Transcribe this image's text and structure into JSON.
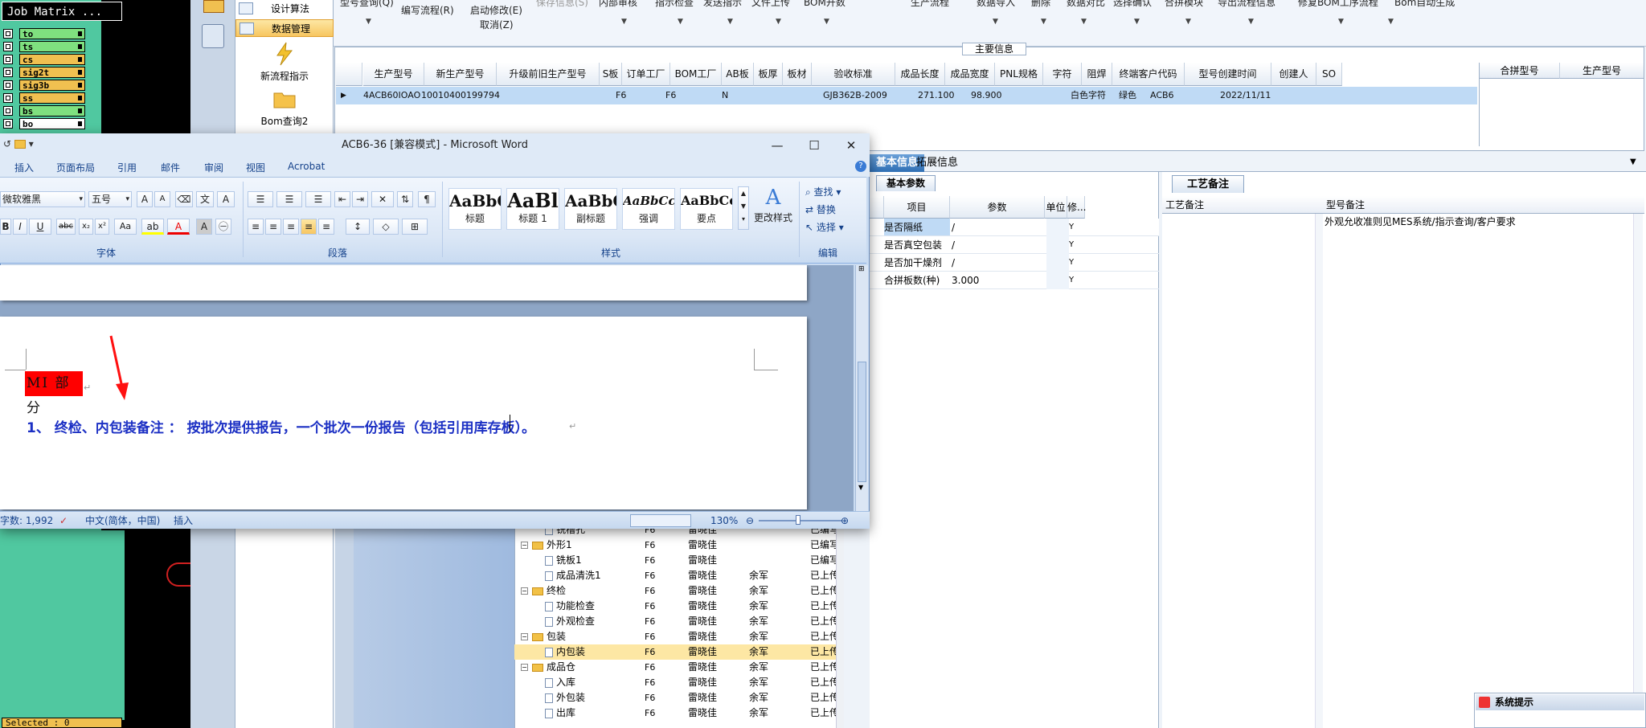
{
  "job_matrix": {
    "title": "Job Matrix ...",
    "layers": [
      {
        "name": "to",
        "color": "#7fe07f"
      },
      {
        "name": "ts",
        "color": "#7fe07f"
      },
      {
        "name": "cs",
        "color": "#f0c050"
      },
      {
        "name": "sig2t",
        "color": "#f0c050"
      },
      {
        "name": "sig3b",
        "color": "#f0c050"
      },
      {
        "name": "ss",
        "color": "#f0c050"
      },
      {
        "name": "bs",
        "color": "#7fe07f"
      },
      {
        "name": "bo",
        "color": "#ffffff"
      }
    ],
    "selected": "Selected : 0"
  },
  "mes_nav": {
    "design_calc": "设计算法",
    "data_mgmt": "数据管理",
    "new_flow": "新流程指示",
    "bom_query": "Bom查询2"
  },
  "menubar": {
    "row1": [
      "型号查询(Q)",
      "保存信息(S)",
      "内部审核",
      "指示检查",
      "发送指示",
      "文件上传",
      "BOM开数",
      "生产流程",
      "数据导入",
      "删除",
      "数据对比",
      "选择确认",
      "合拼模块",
      "导出流程信息",
      "修复BOM工序流程",
      "Bom自动生成"
    ],
    "edit_flow": "编写流程(R)",
    "start_modify": "启动修改(E)",
    "cancel": "取消(Z)"
  },
  "main_info": {
    "title": "主要信息",
    "headers": [
      "生产型号",
      "新生产型号",
      "升级前旧生产型号",
      "S板",
      "订单工厂",
      "BOM工厂",
      "AB板",
      "板厚",
      "板材",
      "验收标准",
      "成品长度",
      "成品宽度",
      "PNL规格",
      "字符",
      "阻焊",
      "终端客户代码",
      "型号创建时间",
      "创建人",
      "SO"
    ],
    "row": {
      "model": "4ACB60IOAO",
      "new_model": "10010400199794",
      "order_factory": "F6",
      "bom_factory": "F6",
      "ab": "N",
      "standard": "GJB362B-2009",
      "length": "271.100",
      "width": "98.900",
      "char": "白色字符",
      "solder": "绿色",
      "customer": "ACB6",
      "created": "2022/11/11"
    },
    "right_headers": [
      "合拼型号",
      "生产型号"
    ]
  },
  "tabs": {
    "basic": "基本信息",
    "ext": "拓展信息"
  },
  "basic_params": {
    "tab": "基本参数",
    "headers": [
      "项目",
      "参数",
      "单位",
      "修..."
    ],
    "rows": [
      {
        "item": "是否隔纸",
        "param": "/",
        "flag": "Y"
      },
      {
        "item": "是否真空包装",
        "param": "/",
        "flag": "Y"
      },
      {
        "item": "是否加干燥剂",
        "param": "/",
        "flag": "Y"
      },
      {
        "item": "合拼板数(种)",
        "param": "3.000",
        "flag": "Y"
      }
    ]
  },
  "process_remark": {
    "tab": "工艺备注",
    "col1": "工艺备注",
    "col2": "型号备注",
    "text": "外观允收准则见MES系统/指示查询/客户要求"
  },
  "sys_note": "系统提示",
  "tree": [
    {
      "indent": 2,
      "type": "doc",
      "name": "铣槽孔",
      "f": "F6",
      "op": "雷晓佳",
      "op2": "",
      "st": "已编写",
      "minus": false
    },
    {
      "indent": 1,
      "type": "folder",
      "name": "外形1",
      "f": "F6",
      "op": "雷晓佳",
      "op2": "",
      "st": "已编写",
      "minus": true
    },
    {
      "indent": 2,
      "type": "doc",
      "name": "铣板1",
      "f": "F6",
      "op": "雷晓佳",
      "op2": "",
      "st": "已编写",
      "minus": false
    },
    {
      "indent": 2,
      "type": "doc",
      "name": "成品清洗1",
      "f": "F6",
      "op": "雷晓佳",
      "op2": "余军",
      "st": "已上传",
      "minus": false
    },
    {
      "indent": 1,
      "type": "folder",
      "name": "终检",
      "f": "F6",
      "op": "雷晓佳",
      "op2": "余军",
      "st": "已上传",
      "minus": true
    },
    {
      "indent": 2,
      "type": "doc",
      "name": "功能检查",
      "f": "F6",
      "op": "雷晓佳",
      "op2": "余军",
      "st": "已上传",
      "minus": false
    },
    {
      "indent": 2,
      "type": "doc",
      "name": "外观检查",
      "f": "F6",
      "op": "雷晓佳",
      "op2": "余军",
      "st": "已上传",
      "minus": false
    },
    {
      "indent": 1,
      "type": "folder",
      "name": "包装",
      "f": "F6",
      "op": "雷晓佳",
      "op2": "余军",
      "st": "已上传",
      "minus": true
    },
    {
      "indent": 2,
      "type": "doc",
      "name": "内包装",
      "f": "F6",
      "op": "雷晓佳",
      "op2": "余军",
      "st": "已上传",
      "minus": false,
      "sel": true
    },
    {
      "indent": 1,
      "type": "folder",
      "name": "成品仓",
      "f": "F6",
      "op": "雷晓佳",
      "op2": "余军",
      "st": "已上传",
      "minus": true
    },
    {
      "indent": 2,
      "type": "doc",
      "name": "入库",
      "f": "F6",
      "op": "雷晓佳",
      "op2": "余军",
      "st": "已上传",
      "minus": false
    },
    {
      "indent": 2,
      "type": "doc",
      "name": "外包装",
      "f": "F6",
      "op": "雷晓佳",
      "op2": "余军",
      "st": "已上传",
      "minus": false
    },
    {
      "indent": 2,
      "type": "doc",
      "name": "出库",
      "f": "F6",
      "op": "雷晓佳",
      "op2": "余军",
      "st": "已上传",
      "minus": false
    }
  ],
  "word": {
    "title": "ACB6-36 [兼容模式] - Microsoft Word",
    "menu": [
      "插入",
      "页面布局",
      "引用",
      "邮件",
      "审阅",
      "视图",
      "Acrobat"
    ],
    "font_name": "微软雅黑",
    "font_size": "五号",
    "groups": {
      "font": "字体",
      "paragraph": "段落",
      "styles": "样式",
      "edit": "编辑"
    },
    "styles": [
      {
        "preview": "AaBbC",
        "name": "标题"
      },
      {
        "preview": "AaBl",
        "name": "标题 1"
      },
      {
        "preview": "AaBbC",
        "name": "副标题"
      },
      {
        "preview": "AaBbCcDd",
        "name": "强调"
      },
      {
        "preview": "AaBbCcD",
        "name": "要点"
      }
    ],
    "change_styles": "更改样式",
    "find": "查找",
    "replace": "替换",
    "select": "选择",
    "mi_part": "MI 部分",
    "note": "1、 终检、内包装备注 ： 按批次提供报告，一个批次一份报告（包括引用库存板）。",
    "status": {
      "words": "字数: 1,992",
      "lang": "中文(简体，中国)",
      "mode": "插入",
      "zoom": "130%"
    }
  },
  "colors": {
    "accent_blue": "#1c30c4",
    "highlight_red": "#ff0000",
    "job_matrix_bg": "#50c8a0"
  }
}
